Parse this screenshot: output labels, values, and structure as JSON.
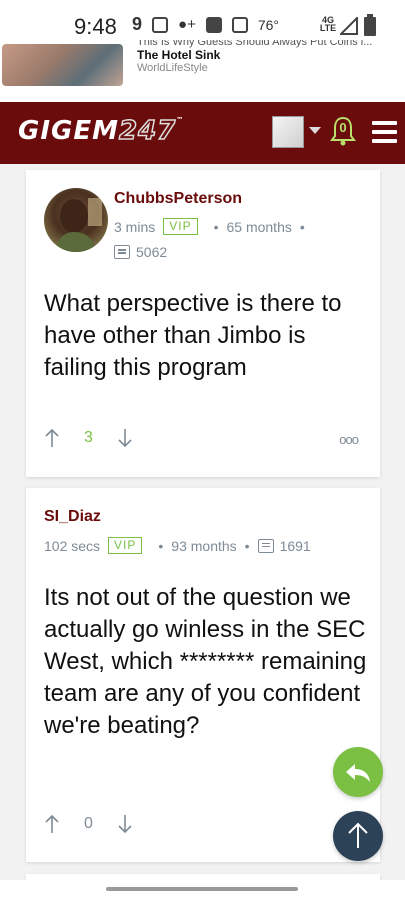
{
  "status_bar": {
    "time": "9:48",
    "temperature": "76°",
    "network": "4G LTE",
    "icons": [
      "app-icon",
      "camera-icon",
      "add-person-icon",
      "facebook-icon",
      "gallery-icon",
      "signal-icon",
      "battery-icon"
    ]
  },
  "ad": {
    "cut_text": "This Is Why Guests Should Always Put Coins i...",
    "title": "The Hotel Sink",
    "source": "WorldLifeStyle"
  },
  "header": {
    "logo_text": "GIGEM",
    "logo_number": "247",
    "logo_tm": "™",
    "notification_count": "0",
    "colors": {
      "header_bg": "#6b0c0c",
      "notification": "#b8e06a"
    }
  },
  "posts": [
    {
      "username": "ChubbsPeterson",
      "time": "3 mins",
      "badge": "VIP",
      "tenure": "65 months",
      "post_count": "5062",
      "body": "What perspective is there to have other than Jimbo is failing this program",
      "score": "3"
    },
    {
      "username": "SI_Diaz",
      "time": "102 secs",
      "badge": "VIP",
      "tenure": "93 months",
      "post_count": "1691",
      "body": "Its not out of the question we actually go winless in the SEC West, which ******** remaining team are any of you confident we're beating?",
      "score": "0"
    }
  ],
  "ui": {
    "more_glyph": "ooo",
    "separator": "•",
    "accent_green": "#7bc043",
    "scroll_top_bg": "#2c4257"
  }
}
